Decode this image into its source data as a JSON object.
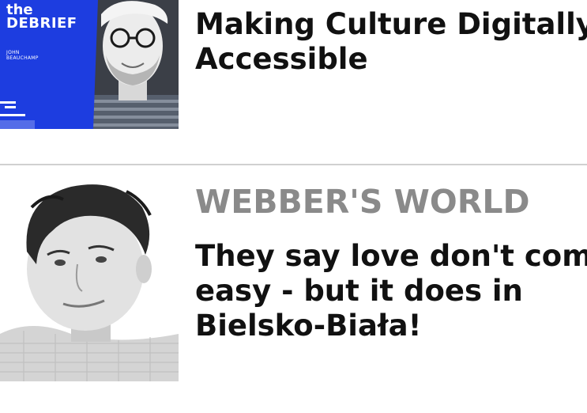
{
  "articles": [
    {
      "thumbnail": {
        "podcast_line1": "the",
        "podcast_line2": "DEBRIEF",
        "host_line1": "JOHN",
        "host_line2": "BEAUCHAMP",
        "background_color": "#1d3de0"
      },
      "title_line1": "Making Culture Digitally",
      "title_line2": "Accessible"
    },
    {
      "kicker": "WEBBER'S WORLD",
      "title_line1": "They say love don't come",
      "title_line2": "easy - but it does in",
      "title_line3": "Bielsko-Biała!"
    }
  ],
  "colors": {
    "headline": "#111111",
    "kicker": "#8a8a8a",
    "divider": "#d0d0d0"
  }
}
